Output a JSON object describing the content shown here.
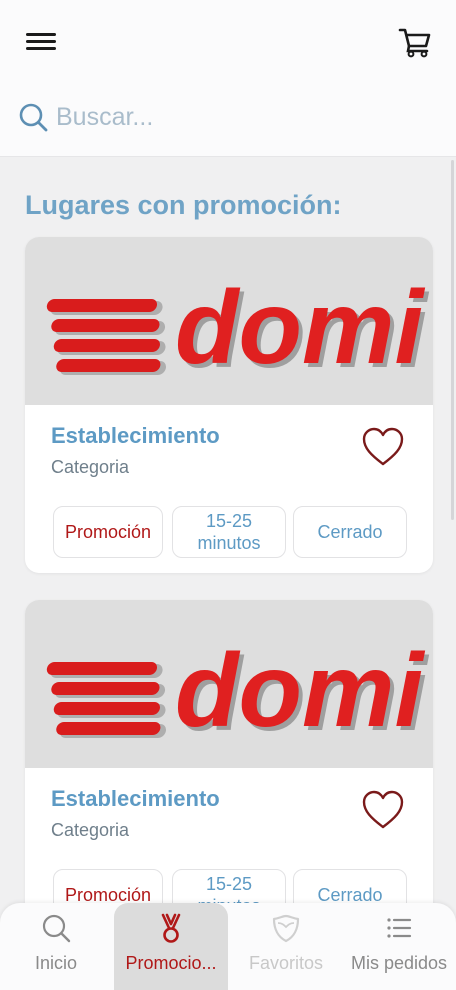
{
  "header": {
    "menu_icon": "hamburger-menu-icon",
    "cart_icon": "shopping-cart-icon"
  },
  "search": {
    "placeholder": "Buscar...",
    "icon": "search-icon"
  },
  "section_title": "Lugares con promoción:",
  "cards": [
    {
      "logo_text": "domi",
      "name": "Establecimiento",
      "category": "Categoria",
      "favorite_icon": "heart-outline-icon",
      "chips": {
        "promo": "Promoción",
        "time_line1": "15-25",
        "time_line2": "minutos",
        "status": "Cerrado"
      }
    },
    {
      "logo_text": "domi",
      "name": "Establecimiento",
      "category": "Categoria",
      "favorite_icon": "heart-outline-icon",
      "chips": {
        "promo": "Promoción",
        "time_line1": "15-25",
        "time_line2": "minutos",
        "status": "Cerrado"
      }
    }
  ],
  "bottom_nav": [
    {
      "label": "Inicio",
      "icon": "search-icon"
    },
    {
      "label": "Promocio...",
      "icon": "medal-icon",
      "active": true
    },
    {
      "label": "Favoritos",
      "icon": "shield-icon"
    },
    {
      "label": "Mis pedidos",
      "icon": "list-icon"
    }
  ],
  "colors": {
    "accent_blue": "#5d9ac4",
    "promo_red": "#b01818",
    "brand_red": "#e02020"
  }
}
